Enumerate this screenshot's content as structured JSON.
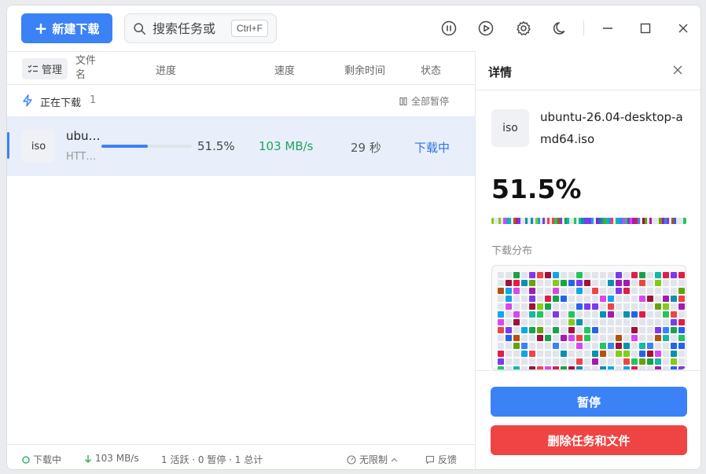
{
  "toolbar": {
    "new_download_label": "新建下载",
    "search_placeholder": "搜索任务或",
    "search_shortcut": "Ctrl+F",
    "icons": [
      "pause-circle-icon",
      "play-circle-icon",
      "gear-icon",
      "moon-icon",
      "minimize-icon",
      "maximize-icon",
      "close-icon"
    ]
  },
  "columns": {
    "manage_label": "管理",
    "filename_line1": "文件",
    "filename_line2": "名",
    "progress": "进度",
    "speed": "速度",
    "remaining": "剩余时间",
    "status": "状态"
  },
  "group": {
    "title": "正在下载",
    "count": "1",
    "pause_all": "全部暂停"
  },
  "tasks": [
    {
      "type": "iso",
      "name": "ubu…",
      "protocol": "HTT…",
      "progress": 0.515,
      "progress_text": "51.5%",
      "speed": "103 MB/s",
      "eta": "29 秒",
      "status": "下载中"
    }
  ],
  "detail": {
    "title": "详情",
    "file_type": "iso",
    "file_name": "ubuntu-26.04-desktop-amd64.iso",
    "percent": "51.5%",
    "distribution_label": "下载分布",
    "pause_button": "暂停",
    "delete_button": "删除任务和文件"
  },
  "statusbar": {
    "state": "下载中",
    "speed": "103 MB/s",
    "summary": "1 活跃 · 0 暂停 · 1 总计",
    "limit": "无限制",
    "feedback": "反馈"
  },
  "colors": {
    "accent": "#3b82f6",
    "danger": "#ef4444",
    "speed_green": "#22a559",
    "row_selected": "#e8effb"
  }
}
